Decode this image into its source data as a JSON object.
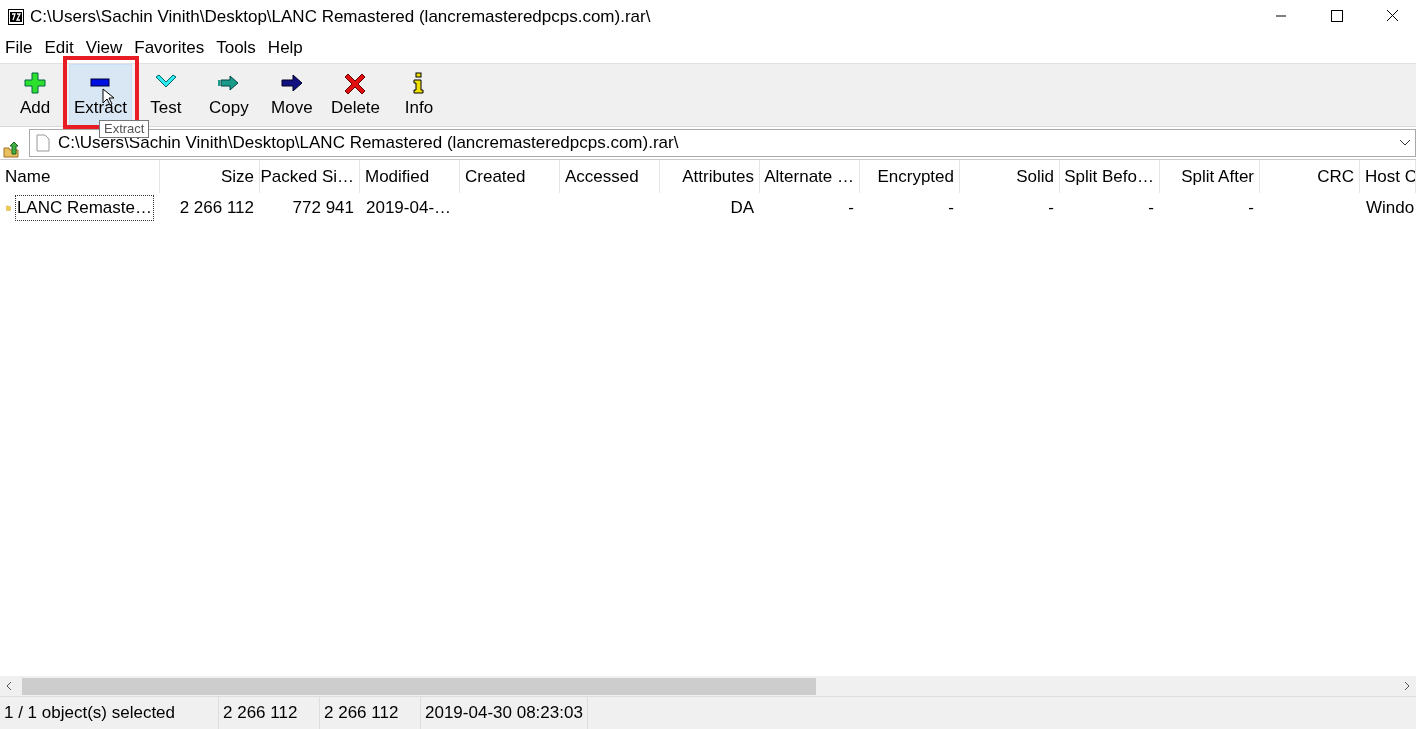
{
  "window": {
    "title": "C:\\Users\\Sachin Vinith\\Desktop\\LANC Remastered (lancremasteredpcps.com).rar\\"
  },
  "menu": [
    "File",
    "Edit",
    "View",
    "Favorites",
    "Tools",
    "Help"
  ],
  "toolbar": [
    {
      "kind": "add",
      "label": "Add",
      "hovered": false,
      "marked": false
    },
    {
      "kind": "extract",
      "label": "Extract",
      "hovered": true,
      "marked": true
    },
    {
      "kind": "test",
      "label": "Test",
      "hovered": false,
      "marked": false
    },
    {
      "kind": "copy",
      "label": "Copy",
      "hovered": false,
      "marked": false
    },
    {
      "kind": "move",
      "label": "Move",
      "hovered": false,
      "marked": false
    },
    {
      "kind": "delete",
      "label": "Delete",
      "hovered": false,
      "marked": false
    },
    {
      "kind": "info",
      "label": "Info",
      "hovered": false,
      "marked": false
    }
  ],
  "tooltip": "Extract",
  "address": {
    "value": "C:\\Users\\Sachin Vinith\\Desktop\\LANC Remastered (lancremasteredpcps.com).rar\\"
  },
  "table": {
    "columns": [
      {
        "kind": "text",
        "label": "Name"
      },
      {
        "kind": "number",
        "label": "Size"
      },
      {
        "kind": "number",
        "label": "Packed Si…"
      },
      {
        "kind": "text",
        "label": "Modified"
      },
      {
        "kind": "text",
        "label": "Created"
      },
      {
        "kind": "text",
        "label": "Accessed"
      },
      {
        "kind": "number",
        "label": "Attributes"
      },
      {
        "kind": "number",
        "label": "Alternate …"
      },
      {
        "kind": "number",
        "label": "Encrypted"
      },
      {
        "kind": "number",
        "label": "Solid"
      },
      {
        "kind": "number",
        "label": "Split Befo…"
      },
      {
        "kind": "number",
        "label": "Split After"
      },
      {
        "kind": "number",
        "label": "CRC"
      },
      {
        "kind": "text",
        "label": "Host C"
      }
    ],
    "rows": [
      {
        "focused": true,
        "cells": [
          "LANC Remaste…",
          "2 266 112",
          "772 941",
          "2019-04-…",
          null,
          null,
          "DA",
          "-",
          "-",
          "-",
          "-",
          "-",
          null,
          "Windo"
        ]
      }
    ]
  },
  "status_bar": [
    "1 / 1 object(s) selected",
    "2 266 112",
    "2 266 112",
    "2019-04-30 08:23:03"
  ]
}
